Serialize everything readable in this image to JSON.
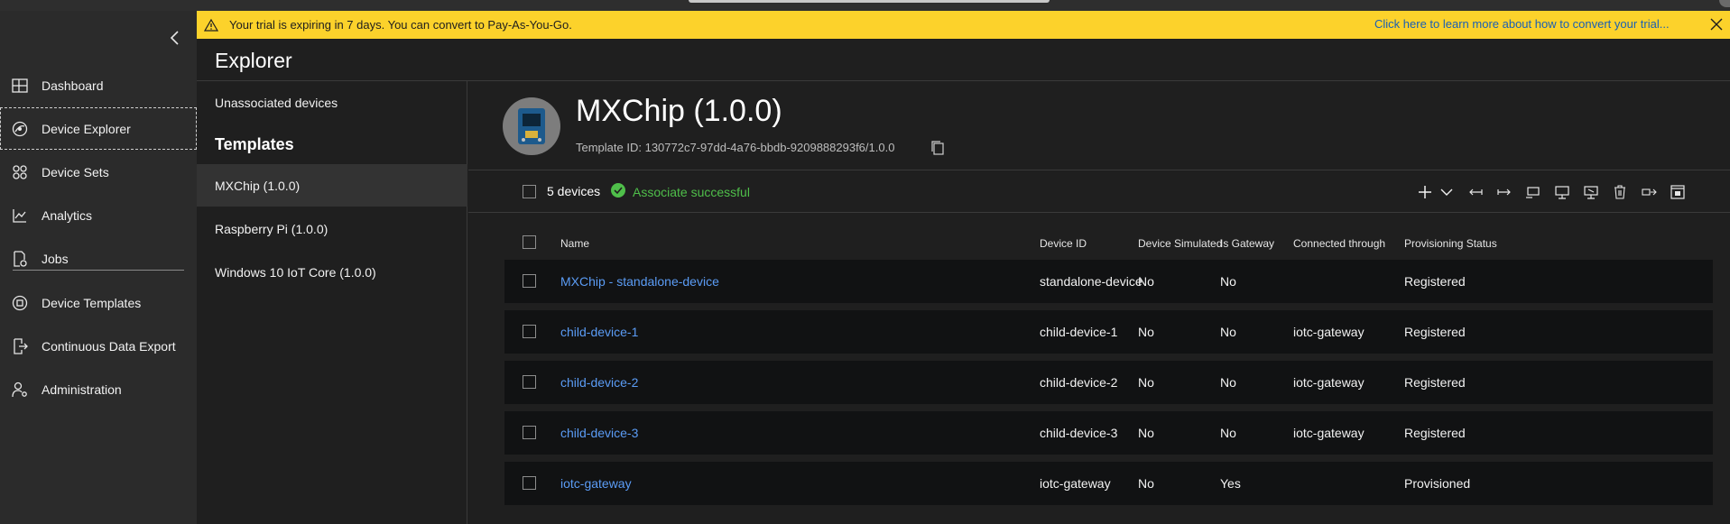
{
  "nav": {
    "items": [
      {
        "label": "Dashboard",
        "icon": "dashboard-icon"
      },
      {
        "label": "Device Explorer",
        "icon": "device-explorer-icon"
      },
      {
        "label": "Device Sets",
        "icon": "device-sets-icon"
      },
      {
        "label": "Analytics",
        "icon": "analytics-icon"
      },
      {
        "label": "Jobs",
        "icon": "jobs-icon"
      },
      {
        "label": "Device Templates",
        "icon": "device-templates-icon"
      },
      {
        "label": "Continuous Data Export",
        "icon": "data-export-icon"
      },
      {
        "label": "Administration",
        "icon": "administration-icon"
      }
    ]
  },
  "banner": {
    "message": "Your trial is expiring in 7 days. You can convert to Pay-As-You-Go.",
    "link": "Click here to learn more about how to convert your trial...",
    "color": "#fcd22b"
  },
  "explorer": {
    "title": "Explorer",
    "unassociated": "Unassociated devices",
    "templates_heading": "Templates",
    "templates": [
      "MXChip (1.0.0)",
      "Raspberry Pi (1.0.0)",
      "Windows 10 IoT Core (1.0.0)"
    ]
  },
  "device": {
    "title": "MXChip (1.0.0)",
    "template_id": "Template ID: 130772c7-97dd-4a76-bbdb-9209888293f6/1.0.0"
  },
  "toolbar": {
    "count": "5 devices",
    "status": "Associate successful",
    "status_color": "#4fbf4a"
  },
  "table": {
    "headers": [
      "Name",
      "Device ID",
      "Device Simulated",
      "Is Gateway",
      "Connected through",
      "Provisioning Status"
    ],
    "rows": [
      {
        "name": "MXChip - standalone-device",
        "device_id": "standalone-device",
        "simulated": "No",
        "gateway": "No",
        "connected": "",
        "status": "Registered"
      },
      {
        "name": "child-device-1",
        "device_id": "child-device-1",
        "simulated": "No",
        "gateway": "No",
        "connected": "iotc-gateway",
        "status": "Registered"
      },
      {
        "name": "child-device-2",
        "device_id": "child-device-2",
        "simulated": "No",
        "gateway": "No",
        "connected": "iotc-gateway",
        "status": "Registered"
      },
      {
        "name": "child-device-3",
        "device_id": "child-device-3",
        "simulated": "No",
        "gateway": "No",
        "connected": "iotc-gateway",
        "status": "Registered"
      },
      {
        "name": "iotc-gateway",
        "device_id": "iotc-gateway",
        "simulated": "No",
        "gateway": "Yes",
        "connected": "",
        "status": "Provisioned"
      }
    ]
  }
}
